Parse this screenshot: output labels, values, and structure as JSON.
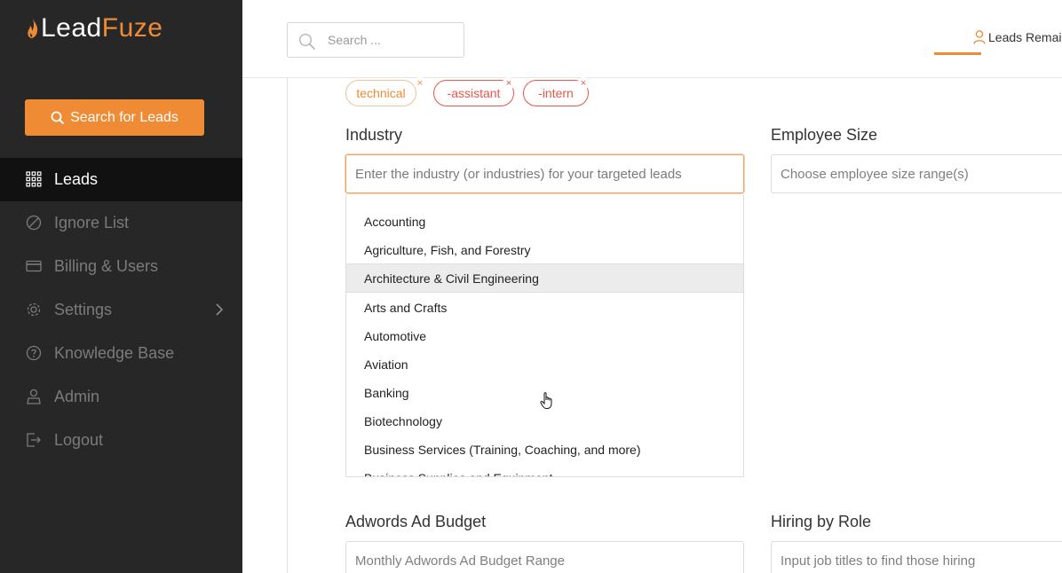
{
  "brand": {
    "name_part1": "Lead",
    "name_part2": "Fuze",
    "accent_color": "#ef8b35"
  },
  "sidebar": {
    "search_button_label": "Search for Leads",
    "items": [
      {
        "label": "Leads",
        "icon": "grid-icon",
        "active": true
      },
      {
        "label": "Ignore List",
        "icon": "ignore-icon"
      },
      {
        "label": "Billing & Users",
        "icon": "credit-card-icon"
      },
      {
        "label": "Settings",
        "icon": "gear-icon",
        "has_submenu": true
      },
      {
        "label": "Knowledge Base",
        "icon": "question-circle-icon"
      },
      {
        "label": "Admin",
        "icon": "admin-icon"
      },
      {
        "label": "Logout",
        "icon": "logout-icon"
      }
    ]
  },
  "header": {
    "search_placeholder": "Search ...",
    "leads_remaining_label": "Leads Remai"
  },
  "filters": {
    "tags": [
      {
        "label": "technical",
        "remove": "×"
      },
      {
        "label": "-assistant",
        "remove": "×"
      },
      {
        "label": "-intern",
        "remove": "×"
      }
    ],
    "industry": {
      "label": "Industry",
      "placeholder": "Enter the industry (or industries) for your targeted leads",
      "options": [
        "Accounting",
        "Agriculture, Fish, and Forestry",
        "Architecture & Civil Engineering",
        "Arts and Crafts",
        "Automotive",
        "Aviation",
        "Banking",
        "Biotechnology",
        "Business Services (Training, Coaching, and more)",
        "Business Supplies and Equipment"
      ],
      "hovered_option": "Architecture & Civil Engineering"
    },
    "employee_size": {
      "label": "Employee Size",
      "placeholder": "Choose employee size range(s)"
    },
    "adwords": {
      "label": "Adwords Ad Budget",
      "placeholder": "Monthly Adwords Ad Budget Range"
    },
    "hiring": {
      "label": "Hiring by Role",
      "placeholder": "Input job titles to find those hiring"
    }
  }
}
